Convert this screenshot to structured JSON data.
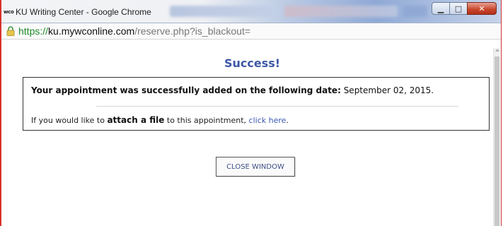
{
  "window": {
    "favicon_text": "wco",
    "title": "KU Writing Center - Google Chrome",
    "minimize_glyph": "▁",
    "maximize_glyph": "□",
    "close_glyph": "✕"
  },
  "address_bar": {
    "url_scheme": "https://",
    "url_host": "ku.mywconline.com",
    "url_path": "/reserve.php?is_blackout=",
    "icon": "lock-icon"
  },
  "page": {
    "heading": "Success!",
    "message_bold": "Your appointment was successfully added on the following date:",
    "message_date": " September 02, 2015.",
    "attach_prefix": "If you would like to ",
    "attach_bold": "attach a file",
    "attach_middle": " to this appointment, ",
    "attach_link": "click here",
    "attach_suffix": ".",
    "close_button": "CLOSE WINDOW"
  },
  "colors": {
    "heading": "#3e57a6",
    "link": "#3b58b2",
    "secure_scheme": "#1f8a2a",
    "window_border": "#d9322b"
  }
}
